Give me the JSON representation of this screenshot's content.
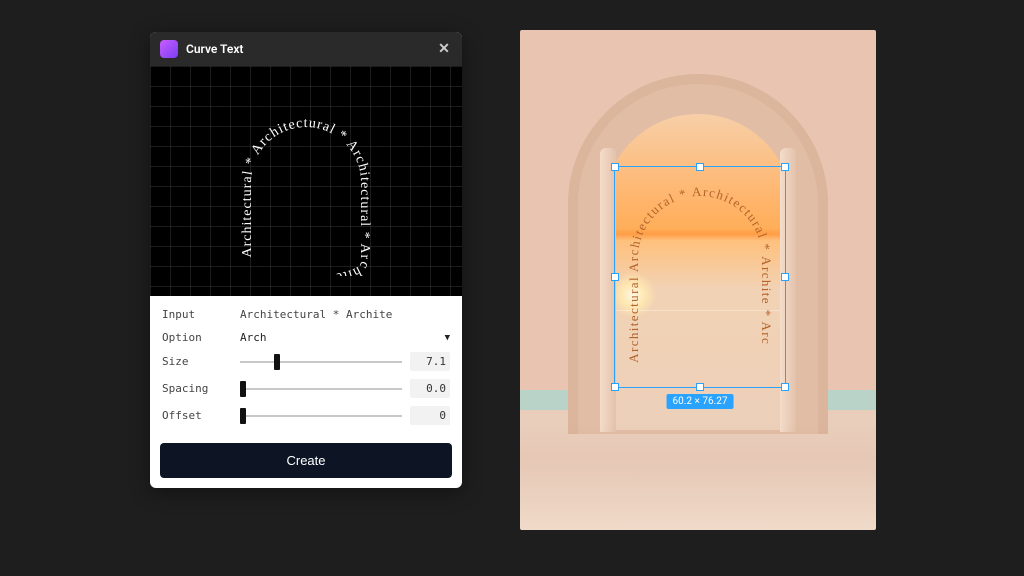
{
  "panel": {
    "title": "Curve Text",
    "preview_text": "Architectural * Architectural * Architectural * Archite",
    "controls": {
      "input": {
        "label": "Input",
        "value": "Architectural * Archite"
      },
      "option": {
        "label": "Option",
        "value": "Arch"
      },
      "size": {
        "label": "Size",
        "value": "7.1",
        "min": 0,
        "max": 20,
        "pos": 22
      },
      "spacing": {
        "label": "Spacing",
        "value": "0.0",
        "min": -5,
        "max": 5,
        "pos": 0
      },
      "offset": {
        "label": "Offset",
        "value": "0",
        "min": -10,
        "max": 10,
        "pos": 0
      }
    },
    "create_label": "Create"
  },
  "canvas": {
    "arch_text": "Architectural Architectural * Architectural * Archite * Arc",
    "selection_dims": "60.2 × 76.27"
  }
}
